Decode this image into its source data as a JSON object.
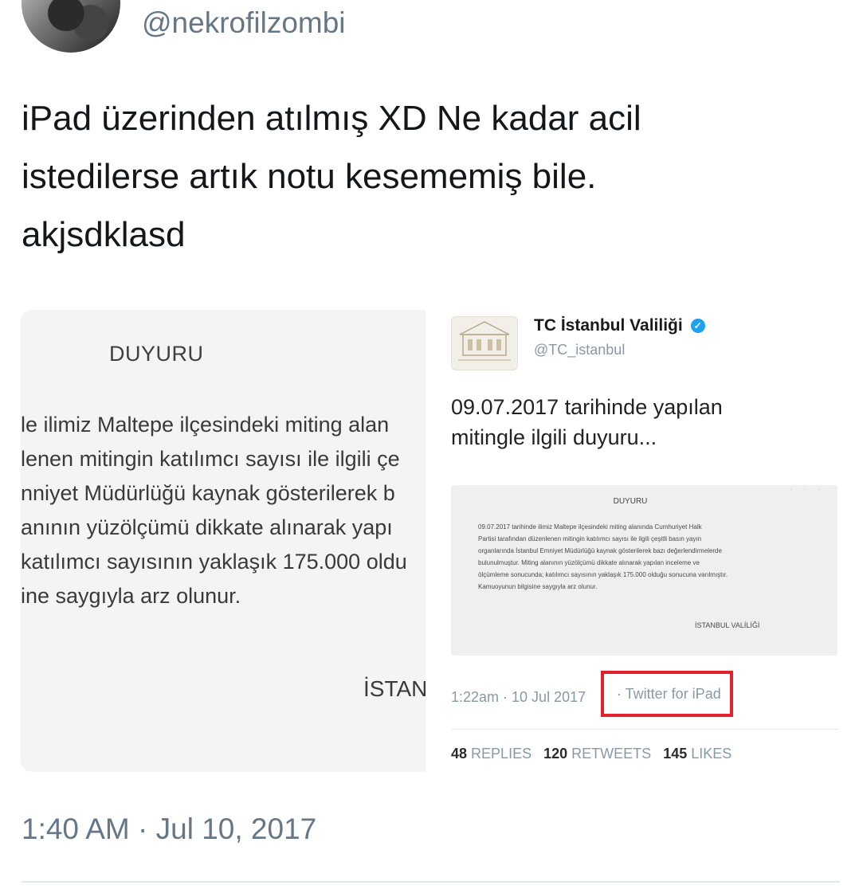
{
  "author": {
    "handle": "@nekrofilzombi"
  },
  "tweet": {
    "lines": [
      "iPad üzerinden atılmış XD Ne kadar acil",
      "istedilerse artık notu kesememiş bile.",
      "akjsdklasd"
    ],
    "timestamp": "1:40 AM · Jul 10, 2017"
  },
  "left_image": {
    "heading": "DUYURU",
    "lines": [
      "le ilimiz Maltepe ilçesindeki miting alan",
      "lenen mitingin katılımcı sayısı ile ilgili çe",
      "nniyet Müdürlüğü kaynak gösterilerek b",
      "anının yüzölçümü dikkate alınarak yapı",
      "katılımcı sayısının yaklaşık 175.000 oldu",
      "ine saygıyla arz olunur."
    ],
    "signature": "İSTAN"
  },
  "embedded_tweet": {
    "name": "TC İstanbul Valiliği",
    "handle": "@TC_istanbul",
    "verified_icon": "verified-badge-icon",
    "text_lines": [
      "09.07.2017 tarihinde yapılan",
      "mitingle ilgili duyuru..."
    ],
    "notice": {
      "title": "DUYURU",
      "lines": [
        "09.07.2017 tarihinde ilimiz Maltepe ilçesindeki miting alanında Cumhuriyet Halk",
        "Partisi tarafından düzenlenen mitingin katılımcı sayısı ile ilgili çeşitli basın yayın",
        "organlarında İstanbul Emniyet Müdürlüğü kaynak gösterilerek bazı değerlendirmelerde",
        "bulunulmuştur. Miting alanının yüzölçümü dikkate alınarak yapılan inceleme ve",
        "ölçümleme sonucunda; katılımcı sayısının yaklaşık 175.000 olduğu sonucuna varılmıştır.",
        "Kamuoyunun bilgisine saygıyla arz olunur."
      ],
      "signature": "İSTANBUL VALİLİĞİ"
    },
    "meta": "1:22am · 10 Jul 2017",
    "source": "· Twitter for iPad",
    "stats": {
      "replies_count": "48",
      "replies_label": "REPLIES",
      "retweets_count": "120",
      "retweets_label": "RETWEETS",
      "likes_count": "145",
      "likes_label": "LIKES"
    },
    "highlight_color": "#e2202e"
  },
  "colors": {
    "secondary_text": "#657786",
    "primary_text": "#14171a",
    "twitter_blue": "#1da1f2"
  }
}
